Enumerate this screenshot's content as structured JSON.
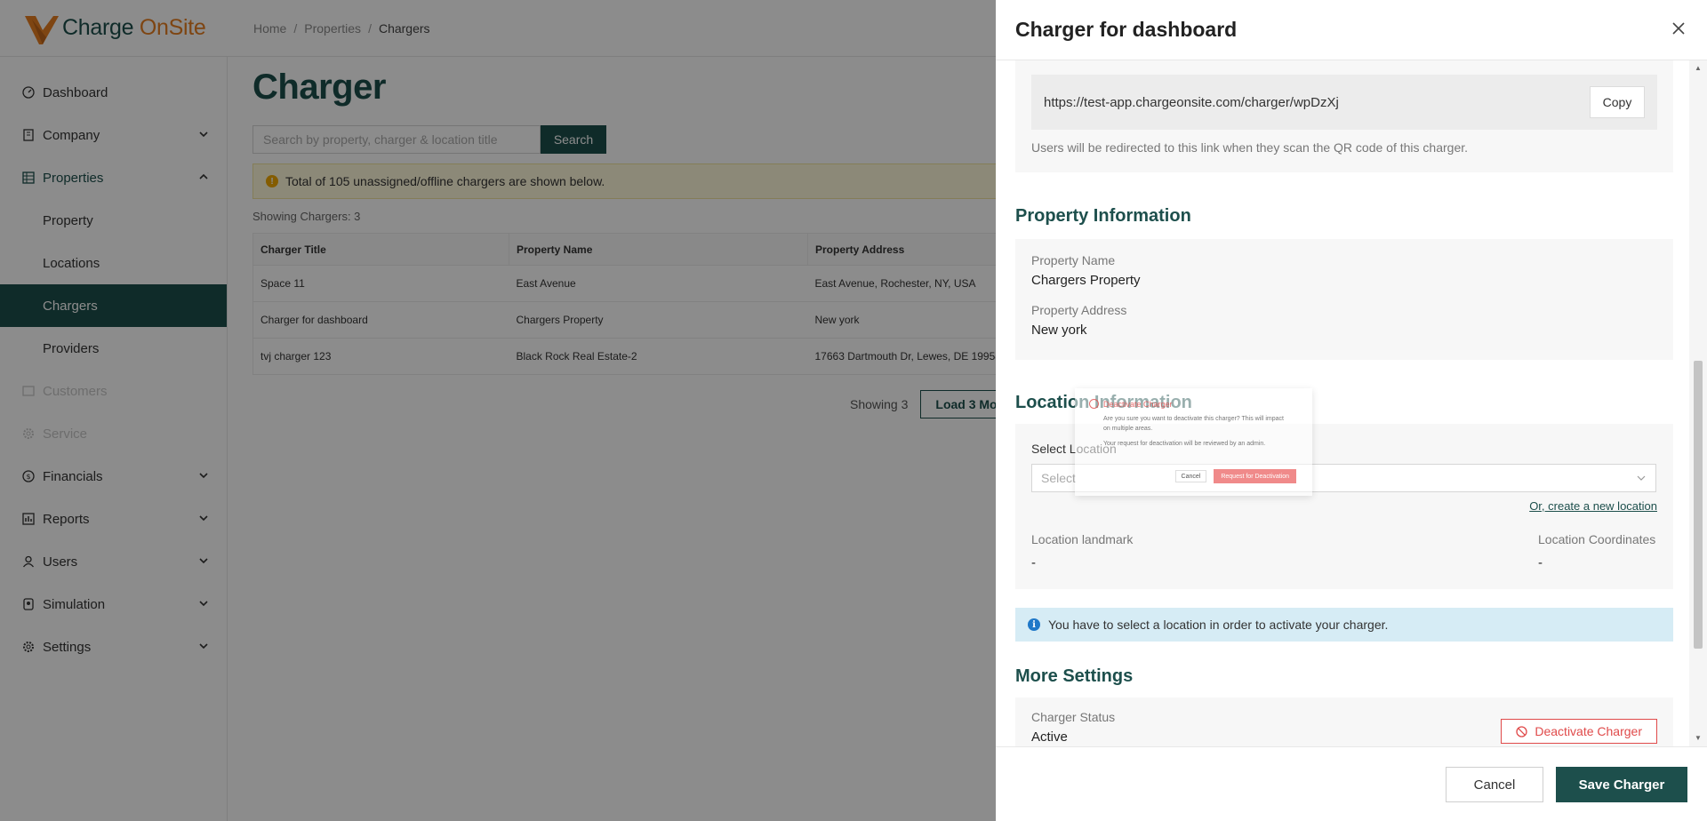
{
  "brand": {
    "name_a": "Charge",
    "name_b": "OnSite",
    "accent": "#1d4f4c",
    "orange": "#e67e22"
  },
  "breadcrumb": [
    "Home",
    "Properties",
    "Chargers"
  ],
  "sidebar": {
    "items": [
      {
        "label": "Dashboard",
        "icon": "dashboard-icon"
      },
      {
        "label": "Company",
        "icon": "company-icon",
        "chevron": "chevron-down-icon"
      },
      {
        "label": "Properties",
        "icon": "grid-icon",
        "chevron": "chevron-up-icon"
      },
      {
        "label": "Customers",
        "icon": "customers-icon"
      },
      {
        "label": "Service",
        "icon": "gear-icon"
      },
      {
        "label": "Financials",
        "icon": "dollar-icon",
        "chevron": "chevron-down-icon"
      },
      {
        "label": "Reports",
        "icon": "reports-icon",
        "chevron": "chevron-down-icon"
      },
      {
        "label": "Users",
        "icon": "user-icon",
        "chevron": "chevron-down-icon"
      },
      {
        "label": "Simulation",
        "icon": "simulation-icon",
        "chevron": "chevron-down-icon"
      },
      {
        "label": "Settings",
        "icon": "gear-icon",
        "chevron": "chevron-down-icon"
      }
    ],
    "sub_items": [
      "Property",
      "Locations",
      "Chargers",
      "Providers"
    ]
  },
  "main": {
    "title": "Charger",
    "search_placeholder": "Search by property, charger & location title",
    "search_button": "Search",
    "alert": "Total of 105 unassigned/offline chargers are shown below.",
    "showing": "Showing Chargers: 3",
    "table": {
      "headers": [
        "Charger Title",
        "Property Name",
        "Property Address"
      ],
      "rows": [
        [
          "Space 11",
          "East Avenue",
          "East Avenue, Rochester, NY, USA"
        ],
        [
          "Charger for dashboard",
          "Chargers Property",
          "New york"
        ],
        [
          "tvj charger 123",
          "Black Rock Real Estate-2",
          "17663 Dartmouth Dr, Lewes, DE 19958"
        ]
      ]
    },
    "pager_text": "Showing 3",
    "load_more": "Load 3 Mo"
  },
  "drawer": {
    "title": "Charger for dashboard",
    "url": "https://test-app.chargeonsite.com/charger/wpDzXj",
    "copy": "Copy",
    "url_hint": "Users will be redirected to this link when they scan the QR code of this charger.",
    "property_section": "Property Information",
    "property_name_label": "Property Name",
    "property_name": "Chargers Property",
    "property_address_label": "Property Address",
    "property_address": "New york",
    "location_section": "Location Information",
    "select_location_label": "Select Location",
    "select_placeholder": "Select",
    "new_location": "Or, create a new location",
    "landmark_label": "Location landmark",
    "landmark_value": "-",
    "coords_label": "Location Coordinates",
    "coords_value": "-",
    "info_alert": "You have to select a location in order to activate your charger.",
    "more_section": "More Settings",
    "status_label": "Charger Status",
    "status_value": "Active",
    "deactivate": "Deactivate Charger",
    "cancel": "Cancel",
    "save": "Save Charger"
  },
  "confirm_modal": {
    "title": "Deactivate Charger",
    "text": "Are you sure you want to deactivate this charger? This will impact on multiple areas.",
    "text2": "Your request for deactivation will be reviewed by an admin.",
    "cancel": "Cancel",
    "request": "Request for Deactivation"
  }
}
